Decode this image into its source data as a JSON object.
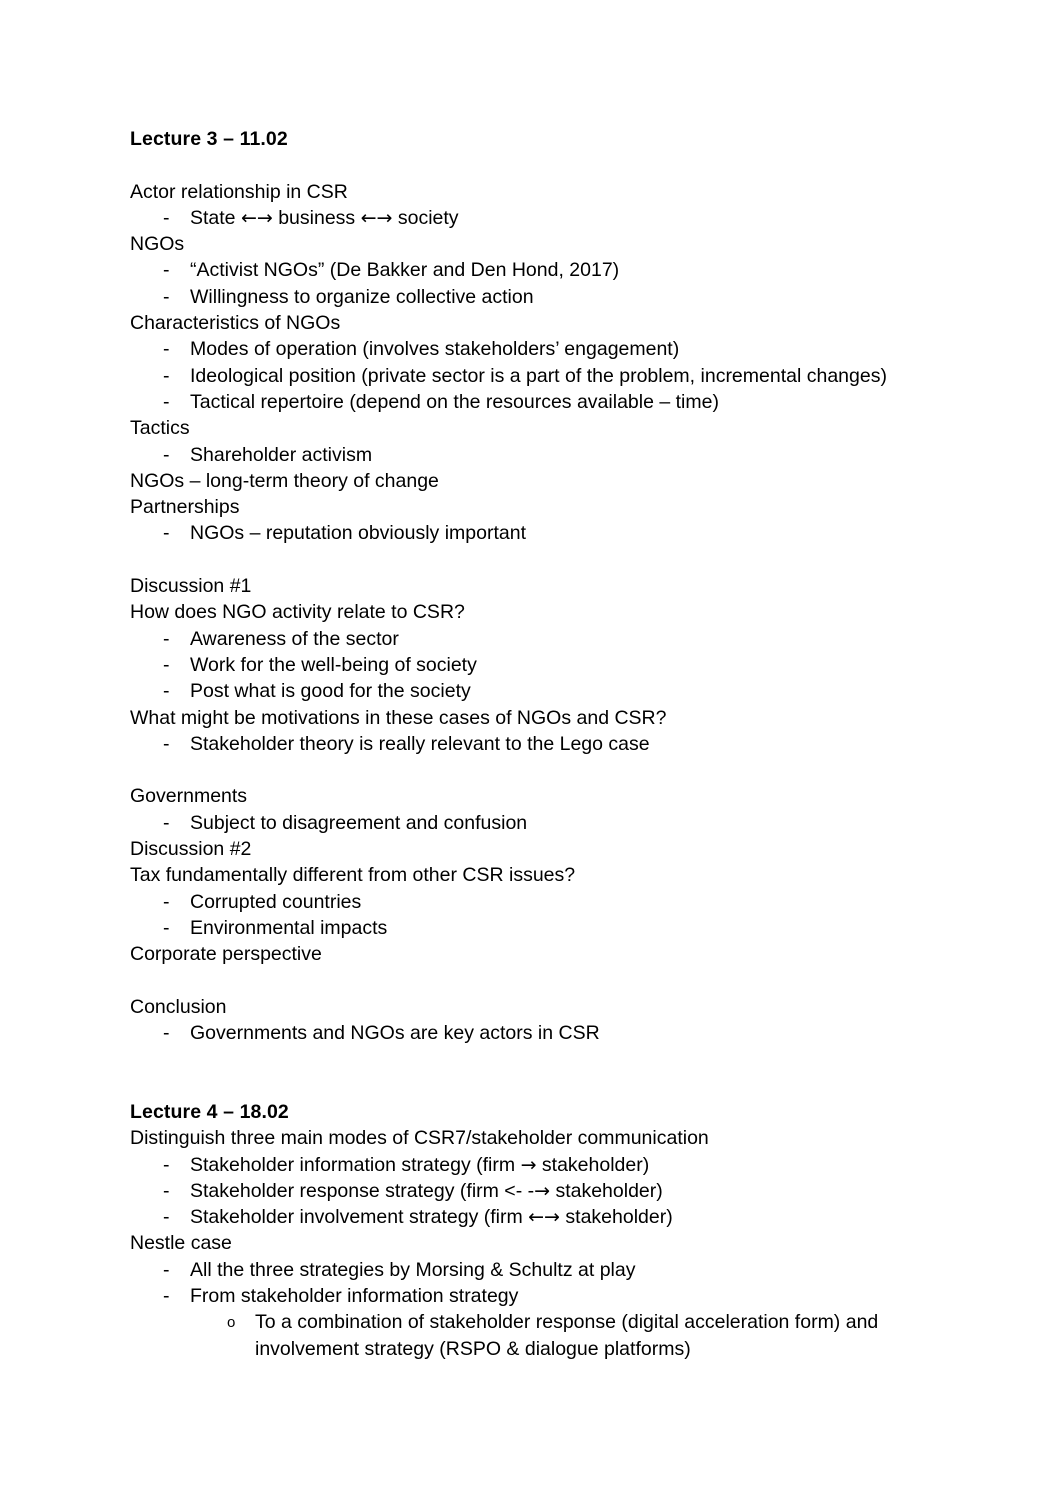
{
  "document": {
    "page_background": "#ffffff",
    "text_color": "#000000",
    "sections": [
      {
        "id": "lecture-3",
        "heading": "Lecture 3 – 11.02",
        "blocks": [
          {
            "type": "blank",
            "text": ""
          },
          {
            "type": "topic",
            "text": "Actor relationship in CSR"
          },
          {
            "type": "bullet",
            "marker": "-",
            "text": "State ←→ business ←→ society"
          },
          {
            "type": "topic",
            "text": "NGOs"
          },
          {
            "type": "bullet",
            "marker": "-",
            "text": "“Activist NGOs” (De Bakker and Den Hond, 2017)"
          },
          {
            "type": "bullet",
            "marker": "-",
            "text": "Willingness to organize collective action"
          },
          {
            "type": "topic",
            "text": "Characteristics of NGOs"
          },
          {
            "type": "bullet",
            "marker": "-",
            "text": "Modes of operation (involves stakeholders’ engagement)"
          },
          {
            "type": "bullet",
            "marker": "-",
            "text": "Ideological position (private sector is a part of the problem, incremental changes)"
          },
          {
            "type": "bullet",
            "marker": "-",
            "text": "Tactical repertoire (depend on the resources available – time)"
          },
          {
            "type": "topic",
            "text": "Tactics"
          },
          {
            "type": "bullet",
            "marker": "-",
            "text": "Shareholder activism"
          },
          {
            "type": "topic",
            "text": "NGOs – long-term theory of change"
          },
          {
            "type": "topic",
            "text": "Partnerships"
          },
          {
            "type": "bullet",
            "marker": "-",
            "text": "NGOs – reputation obviously important"
          },
          {
            "type": "blank",
            "text": ""
          },
          {
            "type": "topic",
            "text": "Discussion #1"
          },
          {
            "type": "topic",
            "text": "How does NGO activity relate to CSR?"
          },
          {
            "type": "bullet",
            "marker": "-",
            "text": "Awareness of the sector"
          },
          {
            "type": "bullet",
            "marker": "-",
            "text": "Work for the well-being of society"
          },
          {
            "type": "bullet",
            "marker": "-",
            "text": "Post what is good for the society"
          },
          {
            "type": "topic",
            "text": "What might be motivations in these cases of NGOs and CSR?"
          },
          {
            "type": "bullet",
            "marker": "-",
            "text": "Stakeholder theory is really relevant to the Lego case"
          },
          {
            "type": "blank",
            "text": ""
          },
          {
            "type": "topic",
            "text": "Governments"
          },
          {
            "type": "bullet",
            "marker": "-",
            "text": "Subject to disagreement and confusion"
          },
          {
            "type": "topic",
            "text": "Discussion #2"
          },
          {
            "type": "topic",
            "text": "Tax fundamentally different from other CSR issues?"
          },
          {
            "type": "bullet",
            "marker": "-",
            "text": "Corrupted countries"
          },
          {
            "type": "bullet",
            "marker": "-",
            "text": "Environmental impacts"
          },
          {
            "type": "topic",
            "text": "Corporate perspective"
          },
          {
            "type": "blank",
            "text": ""
          },
          {
            "type": "topic",
            "text": "Conclusion"
          },
          {
            "type": "bullet",
            "marker": "-",
            "text": "Governments and NGOs are key actors in CSR"
          },
          {
            "type": "blank",
            "text": ""
          },
          {
            "type": "blank",
            "text": ""
          }
        ]
      },
      {
        "id": "lecture-4",
        "heading": "Lecture 4 – 18.02",
        "blocks": [
          {
            "type": "topic",
            "text": "Distinguish three main modes of CSR7/stakeholder communication"
          },
          {
            "type": "bullet",
            "marker": "-",
            "text": "Stakeholder information strategy (firm → stakeholder)"
          },
          {
            "type": "bullet",
            "marker": "-",
            "text": "Stakeholder response strategy (firm <- -→ stakeholder)"
          },
          {
            "type": "bullet",
            "marker": "-",
            "text": "Stakeholder involvement strategy (firm ←→ stakeholder)"
          },
          {
            "type": "topic",
            "text": "Nestle case"
          },
          {
            "type": "bullet",
            "marker": "-",
            "text": "All the three strategies by Morsing & Schultz at play"
          },
          {
            "type": "bullet",
            "marker": "-",
            "text": "From stakeholder information strategy"
          },
          {
            "type": "subbullet",
            "marker": "o",
            "text": "To a combination of stakeholder response (digital acceleration form) and involvement strategy (RSPO & dialogue platforms)"
          }
        ]
      }
    ]
  }
}
